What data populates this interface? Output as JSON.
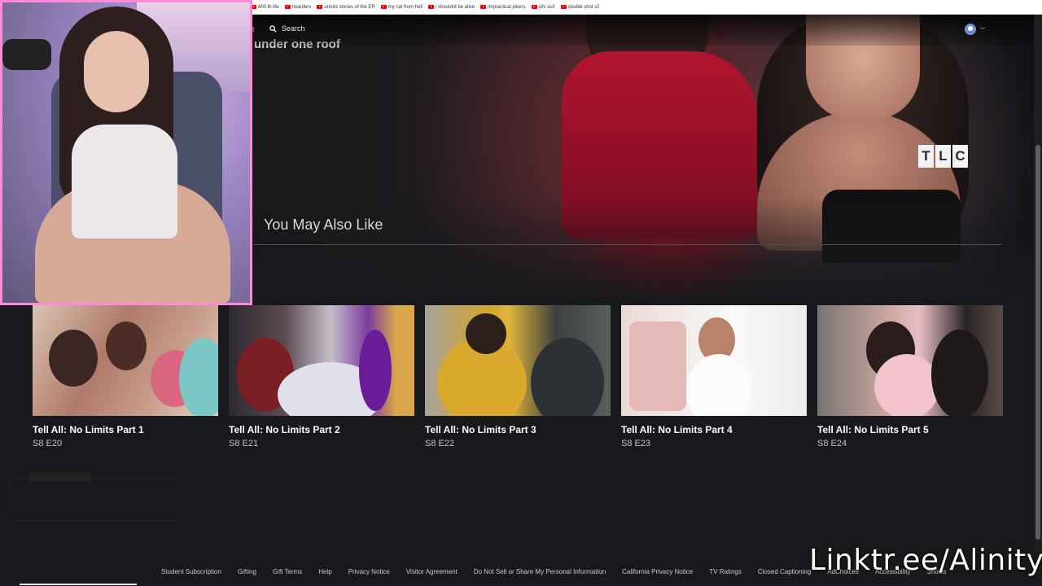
{
  "bookmarks": [
    {
      "label": "600 lb life"
    },
    {
      "label": "hoarders"
    },
    {
      "label": "untold stories of the ER"
    },
    {
      "label": "my cat from hell"
    },
    {
      "label": "i shouldnt be alive"
    },
    {
      "label": "impractical jokers"
    },
    {
      "label": "jsfv ss3"
    },
    {
      "label": "double shot s2"
    }
  ],
  "nav": {
    "partial_item": "t",
    "search_label": "Search"
  },
  "hero": {
    "subtitle": "under one roof",
    "network_logo": "TLC"
  },
  "section": {
    "title": "You May Also Like"
  },
  "cards": [
    {
      "title": "Tell All: No Limits Part 1",
      "episode": "S8 E20"
    },
    {
      "title": "Tell All: No Limits Part 2",
      "episode": "S8 E21"
    },
    {
      "title": "Tell All: No Limits Part 3",
      "episode": "S8 E22"
    },
    {
      "title": "Tell All: No Limits Part 4",
      "episode": "S8 E23"
    },
    {
      "title": "Tell All: No Limits Part 5",
      "episode": "S8 E24"
    }
  ],
  "footer": {
    "links": [
      "Student Subscription",
      "Gifting",
      "Gift Terms",
      "Help",
      "Privacy Notice",
      "Visitor Agreement",
      "Do Not Sell or Share My Personal Information",
      "California Privacy Notice",
      "TV Ratings",
      "Closed Captioning",
      "AdChoices",
      "Accessibility",
      "Shows"
    ]
  },
  "overlay": {
    "watermark": "Linktr.ee/Alinity"
  },
  "colors": {
    "accent_webcam_border": "#ff8ad8",
    "background": "#17191c",
    "bookmark_icon": "#ee0000"
  }
}
